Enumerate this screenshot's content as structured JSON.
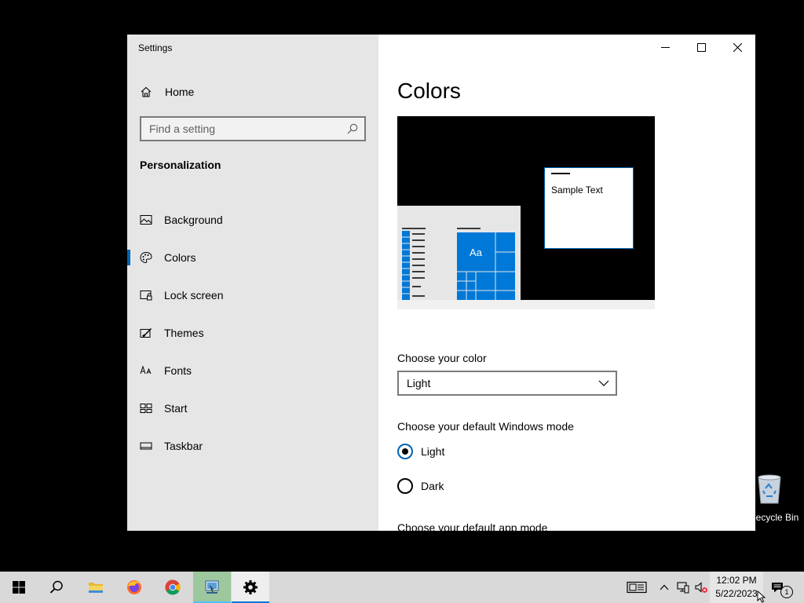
{
  "window": {
    "title": "Settings"
  },
  "sidebar": {
    "home_label": "Home",
    "search_placeholder": "Find a setting",
    "section_title": "Personalization",
    "items": [
      {
        "label": "Background",
        "icon": "picture-icon"
      },
      {
        "label": "Colors",
        "icon": "palette-icon",
        "active": true
      },
      {
        "label": "Lock screen",
        "icon": "lock-screen-icon"
      },
      {
        "label": "Themes",
        "icon": "brush-icon"
      },
      {
        "label": "Fonts",
        "icon": "fonts-icon"
      },
      {
        "label": "Start",
        "icon": "start-tiles-icon"
      },
      {
        "label": "Taskbar",
        "icon": "taskbar-icon"
      }
    ]
  },
  "content": {
    "title": "Colors",
    "preview": {
      "sample_text": "Sample Text",
      "tile_text": "Aa"
    },
    "choose_color_label": "Choose your color",
    "choose_color_value": "Light",
    "windows_mode_label": "Choose your default Windows mode",
    "windows_mode_options": [
      {
        "label": "Light",
        "selected": true
      },
      {
        "label": "Dark",
        "selected": false
      }
    ],
    "app_mode_label": "Choose your default app mode"
  },
  "desktop": {
    "recycle_bin_label": "Recycle Bin"
  },
  "taskbar": {
    "time": "12:02 PM",
    "date": "5/22/2023",
    "notification_count": "1"
  },
  "colors": {
    "accent": "#0063b1",
    "tile_blue": "#0078d7",
    "sidebar_bg": "#e6e6e6",
    "taskbar_bg": "#d9d9d9"
  }
}
